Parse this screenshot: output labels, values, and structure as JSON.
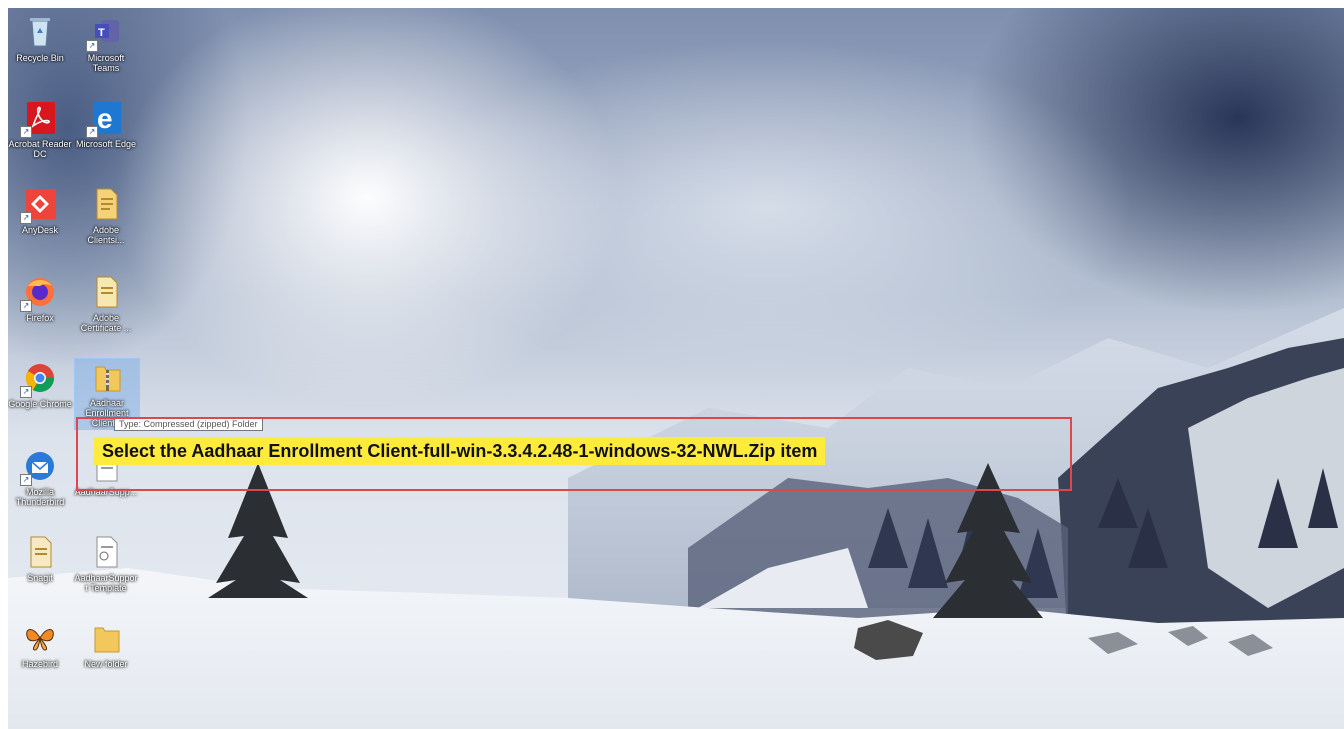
{
  "desktop_icons": [
    {
      "label": "Recycle Bin"
    },
    {
      "label": "Microsoft Teams"
    },
    {
      "label": "Acrobat Reader DC"
    },
    {
      "label": "Microsoft Edge"
    },
    {
      "label": "AnyDesk"
    },
    {
      "label": "Adobe Clientsi..."
    },
    {
      "label": "Firefox"
    },
    {
      "label": "Adobe Certificate ..."
    },
    {
      "label": "Google Chrome"
    },
    {
      "label": "Aadhaar Enrollment Client..."
    },
    {
      "label": "Mozilla Thunderbird"
    },
    {
      "label": "AadhaarSupp..."
    },
    {
      "label": "Snagit"
    },
    {
      "label": "AadhaarSupport Template"
    },
    {
      "label": "Hazebird"
    },
    {
      "label": "New folder"
    }
  ],
  "tooltip": {
    "text": "Type: Compressed (zipped) Folder"
  },
  "instruction": {
    "text": "Select the Aadhaar Enrollment Client-full-win-3.3.4.2.48-1-windows-32-NWL.Zip item"
  },
  "colors": {
    "highlight": "#ffeb3b",
    "box_border": "#e0474c",
    "selection": "#78aae6"
  }
}
